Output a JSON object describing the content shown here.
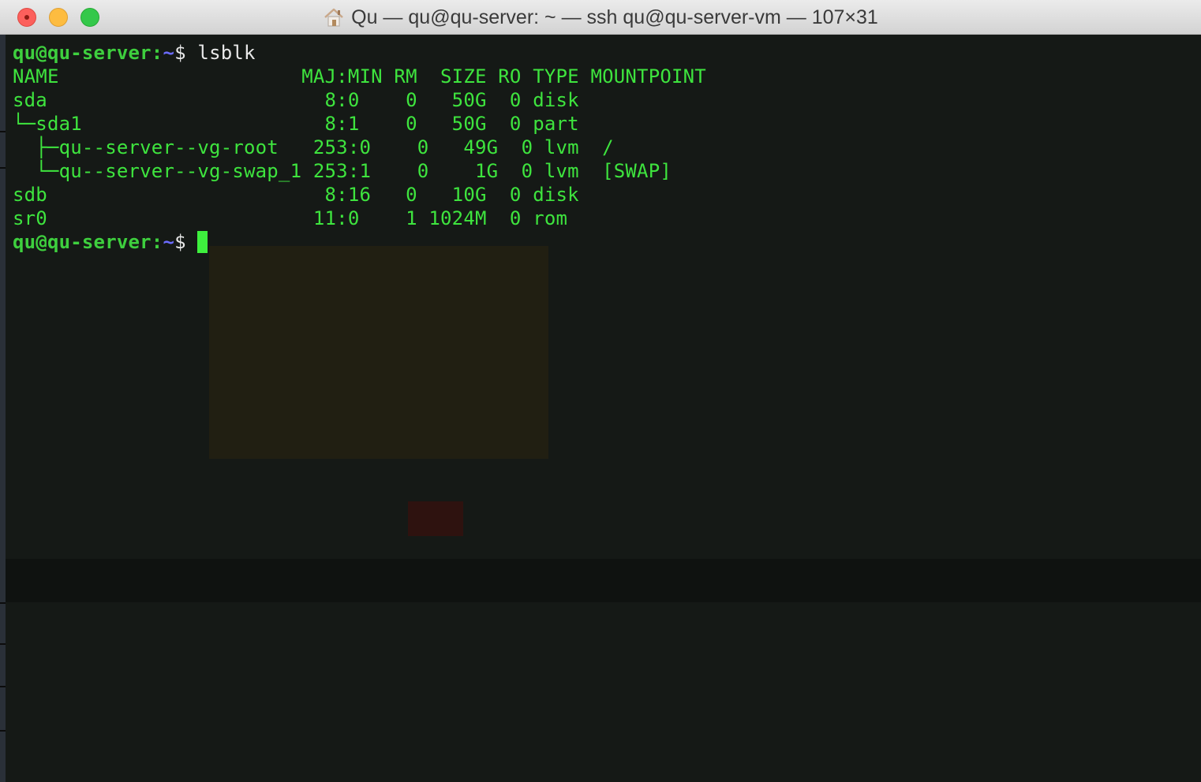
{
  "window": {
    "title": "Qu — qu@qu-server: ~ — ssh qu@qu-server-vm — 107×31",
    "icon": "home-icon"
  },
  "prompt": {
    "user_host": "qu@qu-server",
    "colon": ":",
    "path": "~",
    "sign": "$ "
  },
  "command": "lsblk",
  "output": [
    "NAME                     MAJ:MIN RM  SIZE RO TYPE MOUNTPOINT",
    "sda                        8:0    0   50G  0 disk ",
    "└─sda1                     8:1    0   50G  0 part ",
    "  ├─qu--server--vg-root   253:0    0   49G  0 lvm  /",
    "  └─qu--server--vg-swap_1 253:1    0    1G  0 lvm  [SWAP]",
    "sdb                        8:16   0   10G  0 disk ",
    "sr0                       11:0    1 1024M  0 rom  "
  ],
  "colors": {
    "terminal_bg": "#151916",
    "text_green": "#3ee43e",
    "path_blue": "#6b6bff",
    "cursor": "#3ef03e"
  }
}
